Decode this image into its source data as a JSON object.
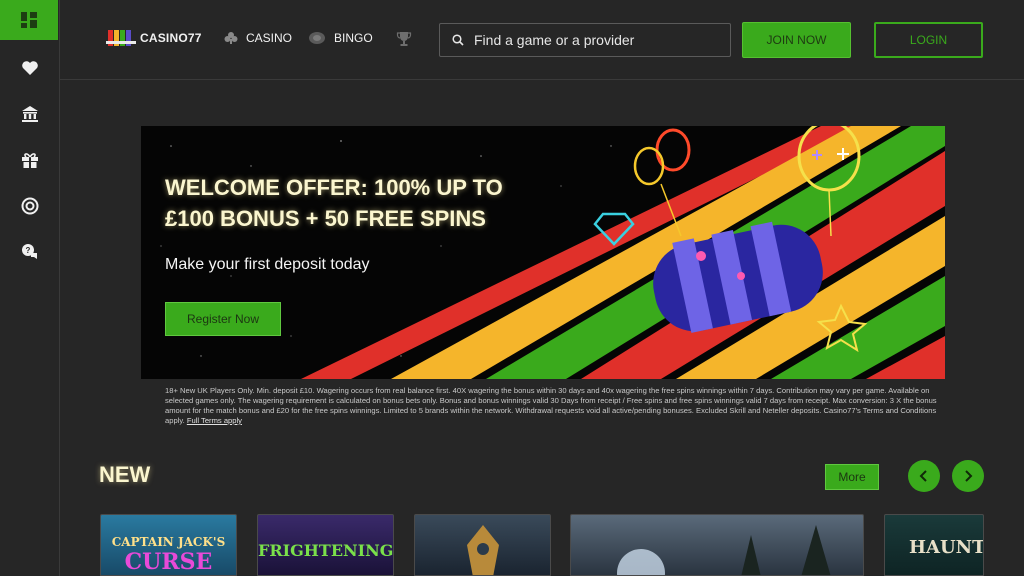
{
  "brand": {
    "name": "CASINO77",
    "accent": "#3aaa1c"
  },
  "sidebar": {
    "items": [
      {
        "icon": "dashboard-icon"
      },
      {
        "icon": "heart-icon"
      },
      {
        "icon": "bank-icon"
      },
      {
        "icon": "gift-icon"
      },
      {
        "icon": "lifebuoy-icon"
      },
      {
        "icon": "chat-help-icon"
      }
    ]
  },
  "header": {
    "nav": [
      {
        "label": "CASINO",
        "icon": "clubs-icon"
      },
      {
        "label": "BINGO",
        "icon": "bingo-ball-icon"
      },
      {
        "label": "",
        "icon": "trophy-icon"
      }
    ],
    "search_placeholder": "Find a game or a provider",
    "join_label": "JOIN NOW",
    "login_label": "LOGIN"
  },
  "banner": {
    "title_line1": "WELCOME OFFER: 100% UP TO",
    "title_line2": "£100 BONUS + 50 FREE SPINS",
    "subtitle": "Make your first deposit today",
    "cta_label": "Register Now"
  },
  "terms": {
    "text": "18+ New UK Players Only. Min. deposit £10. Wagering occurs from real balance first. 40X wagering the bonus within 30 days and 40x wagering the free spins winnings within 7 days. Contribution may vary per game. Available on selected games only. The wagering requirement is calculated on bonus bets only. Bonus and bonus winnings valid 30 Days from receipt / Free spins and free spins winnings valid 7 days from receipt. Max conversion: 3 X the bonus amount for the match bonus and £20 for the free spins winnings. Limited to 5 brands within the network. Withdrawal requests void all active/pending bonuses. Excluded Skrill and Neteller deposits. Casino77's Terms and Conditions apply.",
    "link_label": "Full Terms apply"
  },
  "new_section": {
    "title": "NEW",
    "more_label": "More",
    "prev_icon": "chevron-left-icon",
    "next_icon": "chevron-right-icon",
    "games": [
      {
        "title_line1": "CAPTAIN JACK'S",
        "title_line2": "CURSE"
      },
      {
        "title_line1": "FRIGHTENING",
        "title_line2": ""
      },
      {
        "title_line1": "",
        "title_line2": ""
      },
      {
        "title_line1": "",
        "title_line2": ""
      },
      {
        "title_line1": "HAUNTE",
        "title_line2": ""
      }
    ]
  }
}
